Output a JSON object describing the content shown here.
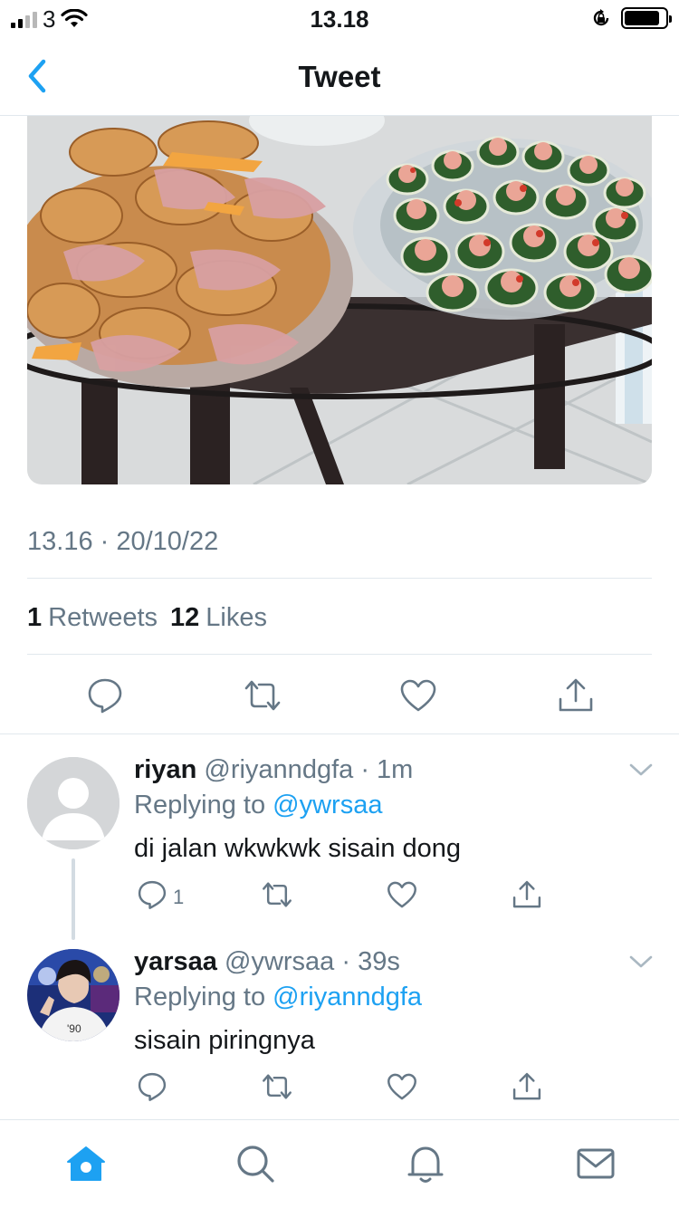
{
  "status_bar": {
    "carrier": "3",
    "time": "13.18"
  },
  "nav": {
    "title": "Tweet"
  },
  "tweet": {
    "image_alt": "food-photo-croissants-and-cucumber-cups",
    "timestamp": "13.16 · 20/10/22",
    "retweets_count": "1",
    "retweets_label": "Retweets",
    "likes_count": "12",
    "likes_label": "Likes"
  },
  "replies": [
    {
      "name": "riyan",
      "handle": "@riyanndgfa",
      "time": "· 1m",
      "replying_prefix": "Replying to ",
      "replying_to": "@ywrsaa",
      "text": "di jalan wkwkwk sisain dong",
      "reply_count": "1"
    },
    {
      "name": "yarsaa",
      "handle": "@ywrsaa",
      "time": "· 39s",
      "replying_prefix": "Replying to ",
      "replying_to": "@riyanndgfa",
      "text": "sisain piringnya",
      "reply_count": ""
    }
  ],
  "colors": {
    "accent": "#1da1f2",
    "muted": "#657786",
    "divider": "#e1e8ed",
    "icon": "#657786"
  },
  "icons": {
    "back": "chevron-left-icon",
    "reply": "reply-icon",
    "retweet": "retweet-icon",
    "like": "heart-icon",
    "share": "share-icon",
    "home": "home-icon",
    "search": "search-icon",
    "notifications": "bell-icon",
    "messages": "mail-icon"
  }
}
